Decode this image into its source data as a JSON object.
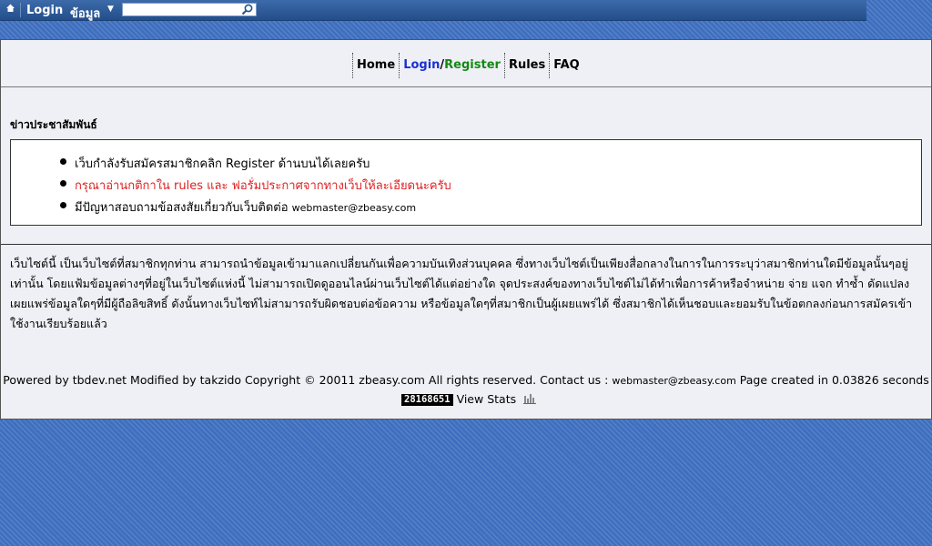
{
  "topbar": {
    "login_label": "Login",
    "info_menu_label": "ข้อมูล",
    "search_placeholder": ""
  },
  "nav": {
    "home": "Home",
    "login": "Login",
    "slash": "/",
    "register": "Register",
    "rules": "Rules",
    "faq": "FAQ"
  },
  "news": {
    "title": "ข่าวประชาสัมพันธ์",
    "items": [
      "เว็บกำลังรับสมัครสมาชิกคลิก Register ด้านบนได้เลยครับ",
      "กรุณาอ่านกติกาใน rules และ ฟอรั่มประกาศจากทางเว็บให้ละเอียดนะครับ",
      "มีปัญหาสอบถามข้อสงสัยเกี่ยวกับเว็บติดต่อ"
    ],
    "contact_email": "webmaster@zbeasy.com"
  },
  "disclaimer": "เว็บไซต์นี้ เป็นเว็บไซต์ที่สมาชิกทุกท่าน สามารถนำข้อมูลเข้ามาแลกเปลี่ยนกันเพื่อความบันเทิงส่วนบุคคล ซึ่งทางเว็บไซต์เป็นเพียงสื่อกลางในการในการระบุว่าสมาชิกท่านใดมีข้อมูลนั้นๆอยู่เท่านั้น โดยแฟ้มข้อมูลต่างๆที่อยู่ในเว็บไซต์แห่งนี้ ไม่สามารถเปิดดูออนไลน์ผ่านเว็บไซต์ได้แต่อย่างใด จุดประสงค์ของทางเว็บไซต์ไม่ได้ทำเพื่อการค้าหรือจำหน่าย จ่าย แจก ทำซ้ำ ดัดแปลง เผยแพร่ข้อมูลใดๆที่มีผู้ถือลิขสิทธิ์ ดังนั้นทางเว็บไซท์ไม่สามารถรับผิดชอบต่อข้อความ หรือข้อมูลใดๆที่สมาชิกเป็นผู้เผยแพร่ได้ ซึ่งสมาชิกได้เห็นชอบและยอมรับในข้อตกลงก่อนการสมัครเข้าใช้งานเรียบร้อยแล้ว",
  "footer": {
    "text_before_email": "Powered by tbdev.net  Modified by takzido Copyright © 20011 zbeasy.com All rights reserved. Contact us : ",
    "email": "webmaster@zbeasy.com",
    "text_after_email": " Page created in 0.03826 seconds",
    "counter": "28168651",
    "view_stats_label": "View Stats"
  },
  "colors": {
    "topbar": "#2b5794",
    "background": "#3f6fbf",
    "panel": "#eff0f5",
    "login_link": "#1b2fd4",
    "register_link": "#138a13",
    "notice_red": "#e02020"
  },
  "icons": [
    "home-icon",
    "chevron-down-icon",
    "search-icon",
    "bar-chart-icon"
  ]
}
